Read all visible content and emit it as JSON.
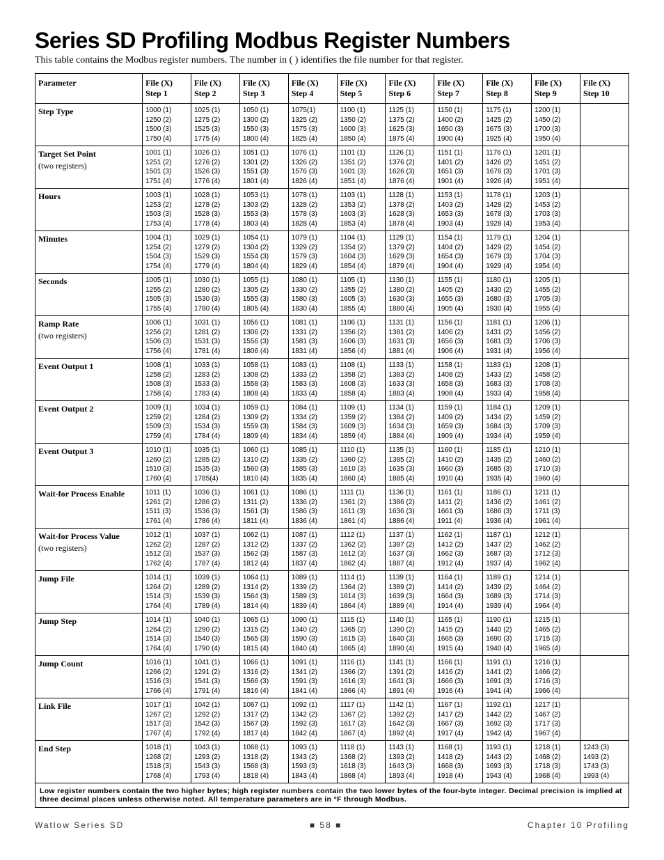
{
  "title": "Series SD Profiling Modbus Register Numbers",
  "subtitle": "This table contains the Modbus register numbers. The number in ( ) identifies the file number for that register.",
  "headers": [
    "Parameter",
    "File (X) Step 1",
    "File (X) Step 2",
    "File (X) Step 3",
    "File (X) Step 4",
    "File (X) Step 5",
    "File (X) Step 6",
    "File (X) Step 7",
    "File (X) Step 8",
    "File (X) Step 9",
    "File (X) Step 10"
  ],
  "rows": [
    {
      "param": "Step Type",
      "sub": "",
      "cells": [
        [
          "1000 (1)",
          "1250 (2)",
          "1500 (3)",
          "1750 (4)"
        ],
        [
          "1025 (1)",
          "1275 (2)",
          "1525 (3)",
          "1775 (4)"
        ],
        [
          "1050 (1)",
          "1300 (2)",
          "1550 (3)",
          "1800 (4)"
        ],
        [
          "1075(1)",
          "1325 (2)",
          "1575 (3)",
          "1825 (4)"
        ],
        [
          "1100 (1)",
          "1350 (2)",
          "1600 (3)",
          "1850 (4)"
        ],
        [
          "1125 (1)",
          "1375 (2)",
          "1625 (3)",
          "1875 (4)"
        ],
        [
          "1150 (1)",
          "1400 (2)",
          "1650 (3)",
          "1900 (4)"
        ],
        [
          "1175 (1)",
          "1425 (2)",
          "1675 (3)",
          "1925 (4)"
        ],
        [
          "1200 (1)",
          "1450 (2)",
          "1700 (3)",
          "1950 (4)"
        ],
        []
      ]
    },
    {
      "param": "Target Set Point",
      "sub": "(two registers)",
      "cells": [
        [
          "1001 (1)",
          "1251 (2)",
          "1501 (3)",
          "1751 (4)"
        ],
        [
          "1026 (1)",
          "1276 (2)",
          "1526 (3)",
          "1776 (4)"
        ],
        [
          "1051 (1)",
          "1301 (2)",
          "1551 (3)",
          "1801 (4)"
        ],
        [
          "1076 (1)",
          "1326 (2)",
          "1576 (3)",
          "1826 (4)"
        ],
        [
          "1101 (1)",
          "1351 (2)",
          "1601 (3)",
          "1851 (4)"
        ],
        [
          "1126 (1)",
          "1376 (2)",
          "1626 (3)",
          "1876 (4)"
        ],
        [
          "1151 (1)",
          "1401 (2)",
          "1651 (3)",
          "1901 (4)"
        ],
        [
          "1176 (1)",
          "1426 (2)",
          "1676 (3)",
          "1926 (4)"
        ],
        [
          "1201 (1)",
          "1451 (2)",
          "1701 (3)",
          "1951 (4)"
        ],
        []
      ]
    },
    {
      "param": "Hours",
      "sub": "",
      "cells": [
        [
          "1003 (1)",
          "1253 (2)",
          "1503 (3)",
          "1753 (4)"
        ],
        [
          "1028 (1)",
          "1278 (2)",
          "1528 (3)",
          "1778 (4)"
        ],
        [
          "1053 (1)",
          "1303 (2)",
          "1553 (3)",
          "1803 (4)"
        ],
        [
          "1078 (1)",
          "1328 (2)",
          "1578 (3)",
          "1828 (4)"
        ],
        [
          "1103 (1)",
          "1353 (2)",
          "1603 (3)",
          "1853 (4)"
        ],
        [
          "1128 (1)",
          "1378 (2)",
          "1628 (3)",
          "1878 (4)"
        ],
        [
          "1153 (1)",
          "1403 (2)",
          "1653 (3)",
          "1903 (4)"
        ],
        [
          "1178 (1)",
          "1428 (2)",
          "1678 (3)",
          "1928 (4)"
        ],
        [
          "1203 (1)",
          "1453 (2)",
          "1703 (3)",
          "1953 (4)"
        ],
        []
      ]
    },
    {
      "param": "Minutes",
      "sub": "",
      "cells": [
        [
          "1004 (1)",
          "1254 (2)",
          "1504 (3)",
          "1754 (4)"
        ],
        [
          "1029 (1)",
          "1279 (2)",
          "1529 (3)",
          "1779 (4)"
        ],
        [
          "1054 (1)",
          "1304 (2)",
          "1554 (3)",
          "1804 (4)"
        ],
        [
          "1079 (1)",
          "1329 (2)",
          "1579 (3)",
          "1829 (4)"
        ],
        [
          "1104 (1)",
          "1354 (2)",
          "1604 (3)",
          "1854 (4)"
        ],
        [
          "1129 (1)",
          "1379 (2)",
          "1629 (3)",
          "1879 (4)"
        ],
        [
          "1154 (1)",
          "1404 (2)",
          "1654 (3)",
          "1904 (4)"
        ],
        [
          "1179 (1)",
          "1429 (2)",
          "1679 (3)",
          "1929 (4)"
        ],
        [
          "1204 (1)",
          "1454 (2)",
          "1704 (3)",
          "1954 (4)"
        ],
        []
      ]
    },
    {
      "param": "Seconds",
      "sub": "",
      "cells": [
        [
          "1005 (1)",
          "1255 (2)",
          "1505 (3)",
          "1755 (4)"
        ],
        [
          "1030 (1)",
          "1280 (2)",
          "1530 (3)",
          "1780 (4)"
        ],
        [
          "1055 (1)",
          "1305 (2)",
          "1555 (3)",
          "1805 (4)"
        ],
        [
          "1080 (1)",
          "1330 (2)",
          "1580 (3)",
          "1830 (4)"
        ],
        [
          "1105 (1)",
          "1355 (2)",
          "1605 (3)",
          "1855 (4)"
        ],
        [
          "1130 (1)",
          "1380 (2)",
          "1630 (3)",
          "1880 (4)"
        ],
        [
          "1155 (1)",
          "1405 (2)",
          "1655 (3)",
          "1905 (4)"
        ],
        [
          "1180 (1)",
          "1430 (2)",
          "1680 (3)",
          "1930 (4)"
        ],
        [
          "1205 (1)",
          "1455 (2)",
          "1705 (3)",
          "1955 (4)"
        ],
        []
      ]
    },
    {
      "param": "Ramp Rate",
      "sub": "(two registers)",
      "cells": [
        [
          "1006 (1)",
          "1256 (2)",
          "1506 (3)",
          "1756 (4)"
        ],
        [
          "1031 (1)",
          "1281 (2)",
          "1531 (3)",
          "1781 (4)"
        ],
        [
          "1056 (1)",
          "1306 (2)",
          "1556 (3)",
          "1806 (4)"
        ],
        [
          "1081 (1)",
          "1331 (2)",
          "1581 (3)",
          "1831 (4)"
        ],
        [
          "1106 (1)",
          "1356 (2)",
          "1606 (3)",
          "1856 (4)"
        ],
        [
          "1131 (1)",
          "1381 (2)",
          "1631 (3)",
          "1881 (4)"
        ],
        [
          "1156 (1)",
          "1406 (2)",
          "1656 (3)",
          "1906 (4)"
        ],
        [
          "1181 (1)",
          "1431 (2)",
          "1681 (3)",
          "1931 (4)"
        ],
        [
          "1206 (1)",
          "1456 (2)",
          "1706 (3)",
          "1956 (4)"
        ],
        []
      ]
    },
    {
      "param": "Event Output 1",
      "sub": "",
      "cells": [
        [
          "1008 (1)",
          "1258 (2)",
          "1508 (3)",
          "1758 (4)"
        ],
        [
          "1033 (1)",
          "1283 (2)",
          "1533 (3)",
          "1783 (4)"
        ],
        [
          "1058 (1)",
          "1308 (2)",
          "1558 (3)",
          "1808 (4)"
        ],
        [
          "1083 (1)",
          "1333 (2)",
          "1583 (3)",
          "1833 (4)"
        ],
        [
          "1108 (1)",
          "1358 (2)",
          "1608 (3)",
          "1858 (4)"
        ],
        [
          "1133 (1)",
          "1383 (2)",
          "1633 (3)",
          "1883 (4)"
        ],
        [
          "1158 (1)",
          "1408 (2)",
          "1658 (3)",
          "1908 (4)"
        ],
        [
          "1183 (1)",
          "1433 (2)",
          "1683 (3)",
          "1933 (4)"
        ],
        [
          "1208 (1)",
          "1458 (2)",
          "1708 (3)",
          "1958 (4)"
        ],
        []
      ]
    },
    {
      "param": "Event Output 2",
      "sub": "",
      "cells": [
        [
          "1009 (1)",
          "1259 (2)",
          "1509 (3)",
          "1759 (4)"
        ],
        [
          "1034 (1)",
          "1284 (2)",
          "1534 (3)",
          "1784 (4)"
        ],
        [
          "1059 (1)",
          "1309 (2)",
          "1559 (3)",
          "1809 (4)"
        ],
        [
          "1084 (1)",
          "1334 (2)",
          "1584 (3)",
          "1834 (4)"
        ],
        [
          "1109 (1)",
          "1359 (2)",
          "1609 (3)",
          "1859 (4)"
        ],
        [
          "1134 (1)",
          "1384 (2)",
          "1634 (3)",
          "1884 (4)"
        ],
        [
          "1159 (1)",
          "1409 (2)",
          "1659 (3)",
          "1909 (4)"
        ],
        [
          "1184 (1)",
          "1434 (2)",
          "1684 (3)",
          "1934 (4)"
        ],
        [
          "1209 (1)",
          "1459 (2)",
          "1709 (3)",
          "1959 (4)"
        ],
        []
      ]
    },
    {
      "param": "Event Output 3",
      "sub": "",
      "cells": [
        [
          "1010 (1)",
          "1260 (2)",
          "1510 (3)",
          "1760 (4)"
        ],
        [
          "1035 (1)",
          "1285 (2)",
          "1535 (3)",
          "1785(4)"
        ],
        [
          "1060 (1)",
          "1310 (2)",
          "1560 (3)",
          "1810 (4)"
        ],
        [
          "1085 (1)",
          "1335 (2)",
          "1585 (3)",
          "1835 (4)"
        ],
        [
          "1110 (1)",
          "1360 (2)",
          "1610 (3)",
          "1860 (4)"
        ],
        [
          "1135 (1)",
          "1385 (2)",
          "1635 (3)",
          "1885 (4)"
        ],
        [
          "1160 (1)",
          "1410 (2)",
          "1660 (3)",
          "1910 (4)"
        ],
        [
          "1185 (1)",
          "1435 (2)",
          "1685 (3)",
          "1935 (4)"
        ],
        [
          "1210 (1)",
          "1460 (2)",
          "1710 (3)",
          "1960 (4)"
        ],
        []
      ]
    },
    {
      "param": "Wait-for Process Enable",
      "sub": "",
      "cells": [
        [
          "1011 (1)",
          "1261 (2)",
          "1511 (3)",
          "1761 (4)"
        ],
        [
          "1036 (1)",
          "1286 (2)",
          "1536 (3)",
          "1786 (4)"
        ],
        [
          "1061 (1)",
          "1311 (2)",
          "1561 (3)",
          "1811 (4)"
        ],
        [
          "1086 (1)",
          "1336 (2)",
          "1586 (3)",
          "1836 (4)"
        ],
        [
          "1111 (1)",
          "1361 (2)",
          "1611 (3)",
          "1861 (4)"
        ],
        [
          "1136 (1)",
          "1386 (2)",
          "1636 (3)",
          "1886 (4)"
        ],
        [
          "1161 (1)",
          "1411 (2)",
          "1661 (3)",
          "1911 (4)"
        ],
        [
          "1186 (1)",
          "1436 (2)",
          "1686 (3)",
          "1936 (4)"
        ],
        [
          "1211 (1)",
          "1461 (2)",
          "1711 (3)",
          "1961 (4)"
        ],
        []
      ]
    },
    {
      "param": "Wait-for Process Value",
      "sub": "(two registers)",
      "cells": [
        [
          "1012 (1)",
          "1262 (2)",
          "1512 (3)",
          "1762 (4)"
        ],
        [
          "1037 (1)",
          "1287 (2)",
          "1537 (3)",
          "1787 (4)"
        ],
        [
          "1062 (1)",
          "1312 (2)",
          "1562 (3)",
          "1812 (4)"
        ],
        [
          "1087 (1)",
          "1337 (2)",
          "1587 (3)",
          "1837 (4)"
        ],
        [
          "1112 (1)",
          "1362 (2)",
          "1612 (3)",
          "1862 (4)"
        ],
        [
          "1137 (1)",
          "1387 (2)",
          "1637 (3)",
          "1887 (4)"
        ],
        [
          "1162 (1)",
          "1412 (2)",
          "1662 (3)",
          "1912 (4)"
        ],
        [
          "1187 (1)",
          "1437 (2)",
          "1687 (3)",
          "1937 (4)"
        ],
        [
          "1212 (1)",
          "1462 (2)",
          "1712 (3)",
          "1962 (4)"
        ],
        []
      ]
    },
    {
      "param": "Jump File",
      "sub": "",
      "cells": [
        [
          "1014 (1)",
          "1264 (2)",
          "1514 (3)",
          "1764 (4)"
        ],
        [
          "1039 (1)",
          "1289 (2)",
          "1539 (3)",
          "1789 (4)"
        ],
        [
          "1064 (1)",
          "1314 (2)",
          "1564 (3)",
          "1814 (4)"
        ],
        [
          "1089 (1)",
          "1339 (2)",
          "1589 (3)",
          "1839 (4)"
        ],
        [
          "1114 (1)",
          "1364 (2)",
          "1614 (3)",
          "1864 (4)"
        ],
        [
          "1139 (1)",
          "1389 (2)",
          "1639 (3)",
          "1889 (4)"
        ],
        [
          "1164 (1)",
          "1414 (2)",
          "1664 (3)",
          "1914 (4)"
        ],
        [
          "1189 (1)",
          "1439 (2)",
          "1689 (3)",
          "1939 (4)"
        ],
        [
          "1214 (1)",
          "1464 (2)",
          "1714 (3)",
          "1964 (4)"
        ],
        []
      ]
    },
    {
      "param": "Jump Step",
      "sub": "",
      "cells": [
        [
          "1014 (1)",
          "1264 (2)",
          "1514 (3)",
          "1764 (4)"
        ],
        [
          "1040 (1)",
          "1290 (2)",
          "1540 (3)",
          "1790 (4)"
        ],
        [
          "1065 (1)",
          "1315 (2)",
          "1565 (3)",
          "1815 (4)"
        ],
        [
          "1090 (1)",
          "1340 (2)",
          "1590 (3)",
          "1840 (4)"
        ],
        [
          "1115 (1)",
          "1365 (2)",
          "1615 (3)",
          "1865 (4)"
        ],
        [
          "1140 (1)",
          "1390 (2)",
          "1640 (3)",
          "1890 (4)"
        ],
        [
          "1165 (1)",
          "1415 (2)",
          "1665 (3)",
          "1915 (4)"
        ],
        [
          "1190 (1)",
          "1440 (2)",
          "1690 (3)",
          "1940 (4)"
        ],
        [
          "1215 (1)",
          "1465 (2)",
          "1715 (3)",
          "1965 (4)"
        ],
        []
      ]
    },
    {
      "param": "Jump Count",
      "sub": "",
      "cells": [
        [
          "1016 (1)",
          "1266 (2)",
          "1516 (3)",
          "1766 (4)"
        ],
        [
          "1041 (1)",
          "1291 (2)",
          "1541 (3)",
          "1791 (4)"
        ],
        [
          "1066 (1)",
          "1316 (2)",
          "1566 (3)",
          "1816 (4)"
        ],
        [
          "1091 (1)",
          "1341 (2)",
          "1591 (3)",
          "1841 (4)"
        ],
        [
          "1116 (1)",
          "1366 (2)",
          "1616 (3)",
          "1866 (4)"
        ],
        [
          "1141 (1)",
          "1391 (2)",
          "1641 (3)",
          "1891 (4)"
        ],
        [
          "1166 (1)",
          "1416 (2)",
          "1666 (3)",
          "1916 (4)"
        ],
        [
          "1191 (1)",
          "1441 (2)",
          "1691 (3)",
          "1941 (4)"
        ],
        [
          "1216 (1)",
          "1466 (2)",
          "1716 (3)",
          "1966 (4)"
        ],
        []
      ]
    },
    {
      "param": "Link File",
      "sub": "",
      "cells": [
        [
          "1017 (1)",
          "1267 (2)",
          "1517 (3)",
          "1767 (4)"
        ],
        [
          "1042 (1)",
          "1292 (2)",
          "1542 (3)",
          "1792 (4)"
        ],
        [
          "1067 (1)",
          "1317 (2)",
          "1567 (3)",
          "1817 (4)"
        ],
        [
          "1092 (1)",
          "1342 (2)",
          "1592 (3)",
          "1842 (4)"
        ],
        [
          "1117 (1)",
          "1367 (2)",
          "1617 (3)",
          "1867 (4)"
        ],
        [
          "1142 (1)",
          "1392 (2)",
          "1642 (3)",
          "1892 (4)"
        ],
        [
          "1167 (1)",
          "1417 (2)",
          "1667 (3)",
          "1917 (4)"
        ],
        [
          "1192 (1)",
          "1442 (2)",
          "1692 (3)",
          "1942 (4)"
        ],
        [
          "1217 (1)",
          "1467 (2)",
          "1717 (3)",
          "1967 (4)"
        ],
        []
      ]
    },
    {
      "param": "End Step",
      "sub": "",
      "cells": [
        [
          "1018 (1)",
          "1268 (2)",
          "1518 (3)",
          "1768 (4)"
        ],
        [
          "1043 (1)",
          "1293 (2)",
          "1543 (3)",
          "1793 (4)"
        ],
        [
          "1068 (1)",
          "1318 (2)",
          "1568 (3)",
          "1818 (4)"
        ],
        [
          "1093 (1)",
          "1343 (2)",
          "1593 (3)",
          "1843 (4)"
        ],
        [
          "1118 (1)",
          "1368 (2)",
          "1618 (3)",
          "1868 (4)"
        ],
        [
          "1143 (1)",
          "1393 (2)",
          "1643 (3)",
          "1893 (4)"
        ],
        [
          "1168 (1)",
          "1418 (2)",
          "1668 (3)",
          "1918 (4)"
        ],
        [
          "1193 (1)",
          "1443 (2)",
          "1693 (3)",
          "1943 (4)"
        ],
        [
          "1218 (1)",
          "1468 (2)",
          "1718 (3)",
          "1968 (4)"
        ],
        [
          "1243 (3)",
          "1493 (2)",
          "1743 (3)",
          "1993 (4)"
        ]
      ]
    }
  ],
  "footnote": "Low register numbers contain the two higher bytes; high register numbers contain the two lower bytes of the four-byte integer. Decimal precision is implied at three decimal places unless otherwise noted. All temperature parameters are in °F through Modbus.",
  "footer": {
    "left": "Watlow Series SD",
    "center": "■ 58 ■",
    "right": "Chapter 10 Profiling"
  }
}
